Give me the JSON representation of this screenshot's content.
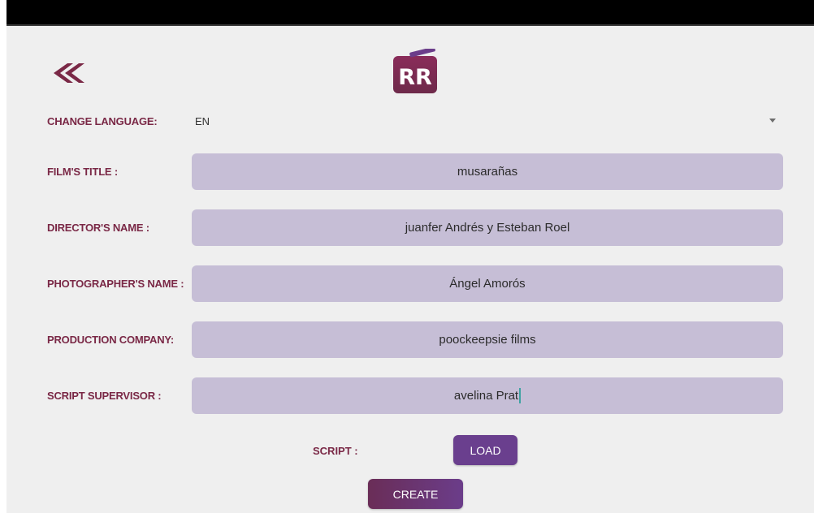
{
  "header": {
    "back_icon": "double-chevron-left-icon",
    "logo_text": "RR",
    "logo_colors": {
      "top": "#7a2846",
      "bottom": "#6b3d8a"
    }
  },
  "language": {
    "label": "CHANGE LANGUAGE:",
    "selected": "EN"
  },
  "form": {
    "film_title": {
      "label": "FILM'S TITLE :",
      "value": "musarañas"
    },
    "director": {
      "label": "DIRECTOR'S NAME :",
      "value": "juanfer Andrés y Esteban Roel"
    },
    "photographer": {
      "label": "PHOTOGRAPHER'S NAME :",
      "value": "Ángel Amorós"
    },
    "production": {
      "label": "PRODUCTION COMPANY:",
      "value": "poockeepsie films"
    },
    "supervisor": {
      "label": "SCRIPT SUPERVISOR :",
      "value": "avelina Prat"
    }
  },
  "script": {
    "label": "SCRIPT :",
    "load_label": "LOAD"
  },
  "create_label": "CREATE",
  "colors": {
    "label": "#7a2846",
    "field_bg": "#c6bed6",
    "button": "#6a3f8e",
    "background": "#efefef"
  }
}
